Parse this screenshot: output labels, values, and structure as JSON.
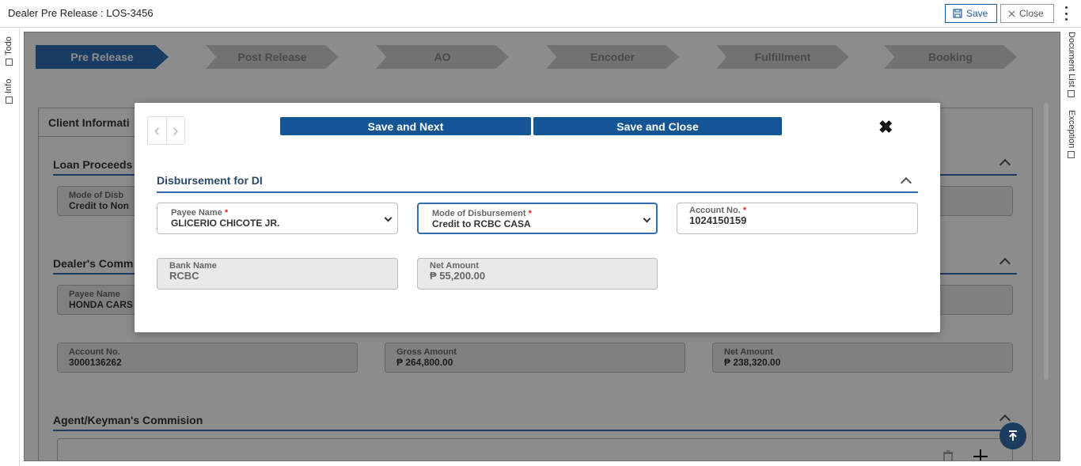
{
  "header": {
    "title": "Dealer Pre Release : LOS-3456",
    "save_label": "Save",
    "close_label": "Close"
  },
  "left_tabs": [
    "Todo",
    "Info"
  ],
  "right_tabs": [
    "Document List",
    "Exception"
  ],
  "steps": [
    "Pre Release",
    "Post Release",
    "AO",
    "Encoder",
    "Fulfillment",
    "Booking"
  ],
  "active_step": "Pre Release",
  "background": {
    "tab_label": "Client Informati",
    "loan_proceeds": {
      "title": "Loan Proceeds",
      "mode_label": "Mode of Disb",
      "mode_value": "Credit to Non"
    },
    "dealers_commission": {
      "title": "Dealer's Comm",
      "payee_label": "Payee Name",
      "payee_value": "HONDA CARS",
      "account_label": "Account No.",
      "account_value": "3000136262",
      "gross_label": "Gross Amount",
      "gross_value": "₱ 264,800.00",
      "net_label": "Net Amount",
      "net_value": "₱ 238,320.00"
    },
    "agent_commission": {
      "title": "Agent/Keyman's Commision"
    }
  },
  "modal": {
    "save_next_label": "Save and Next",
    "save_close_label": "Save and Close",
    "section_title": "Disbursement for DI",
    "payee_label": "Payee Name",
    "payee_value": "GLICERIO CHICOTE JR.",
    "mode_label": "Mode of Disbursement",
    "mode_value": "Credit to RCBC CASA",
    "account_label": "Account No.",
    "account_value": "1024150159",
    "bank_label": "Bank Name",
    "bank_value": "RCBC",
    "net_label": "Net Amount",
    "net_value": "₱ 55,200.00",
    "required_mark": "*"
  },
  "colors": {
    "primary": "#145596",
    "active_step": "#2e6db4",
    "required": "#e02020"
  }
}
